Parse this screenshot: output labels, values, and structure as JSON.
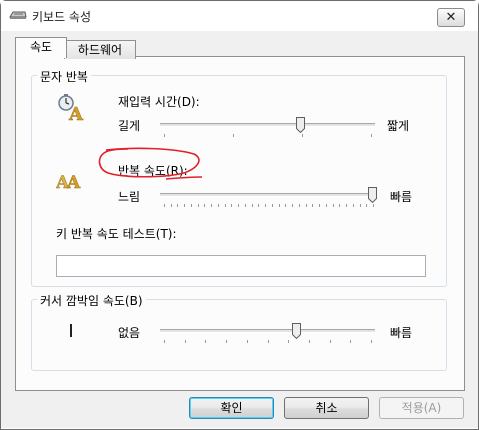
{
  "window": {
    "title": "키보드 속성",
    "close_symbol": "✕"
  },
  "tabs": [
    {
      "label": "속도",
      "selected": true
    },
    {
      "label": "하드웨어",
      "selected": false
    }
  ],
  "repeat_group": {
    "title": "문자 반복",
    "delay": {
      "label": "재입력 시간(D):",
      "min_label": "길게",
      "max_label": "짧게",
      "value_fraction": 0.66
    },
    "rate": {
      "label": "반복 속도(R):",
      "min_label": "느림",
      "max_label": "빠름",
      "value_fraction": 1.0
    },
    "test_label": "키 반복 속도 테스트(T):",
    "test_value": ""
  },
  "blink_group": {
    "title": "커서 깜박임 속도(B)",
    "min_label": "없음",
    "max_label": "빠름",
    "value_fraction": 0.64
  },
  "buttons": {
    "ok": "확인",
    "cancel": "취소",
    "apply": "적용(A)"
  },
  "colors": {
    "annotation": "#e0202a",
    "focus": "#3c7fb1"
  }
}
